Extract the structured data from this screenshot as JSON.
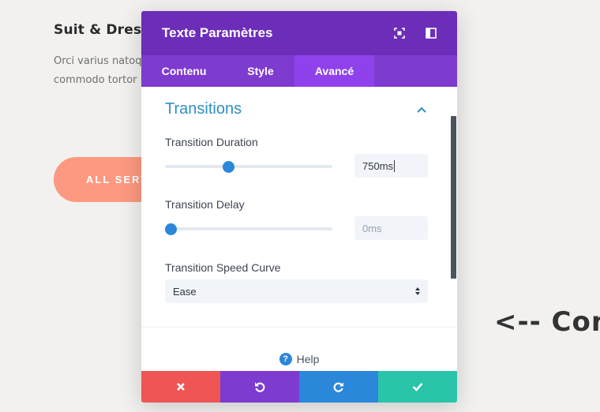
{
  "background": {
    "title": "Suit & Dress",
    "text_line1": "Orci varius natoque",
    "text_line2": "commodo tortor",
    "button_label": "ALL SERVICES",
    "arrow_text": "<-- Con"
  },
  "modal": {
    "title": "Texte Paramètres",
    "header_icons": [
      "expand-icon",
      "split-view-icon"
    ],
    "tabs": [
      {
        "label": "Contenu",
        "active": false
      },
      {
        "label": "Style",
        "active": false
      },
      {
        "label": "Avancé",
        "active": true
      }
    ],
    "section": {
      "title": "Transitions",
      "expanded": true
    },
    "fields": {
      "duration": {
        "label": "Transition Duration",
        "value": "750ms",
        "slider_fraction": 0.38
      },
      "delay": {
        "label": "Transition Delay",
        "placeholder": "0ms",
        "slider_fraction": 0.0
      },
      "speed_curve": {
        "label": "Transition Speed Curve",
        "selected": "Ease"
      }
    },
    "help_label": "Help",
    "footer_buttons": [
      "close-icon",
      "undo-icon",
      "redo-icon",
      "check-icon"
    ]
  },
  "colors": {
    "header": "#6c2eb9",
    "tabs": "#7e3bd0",
    "active_tab": "#8f42ec",
    "accent_blue": "#2b87da",
    "section_title": "#2e8fc4",
    "cancel": "#ef5555",
    "save": "#29c4a9",
    "bg_button": "#fd9980"
  }
}
